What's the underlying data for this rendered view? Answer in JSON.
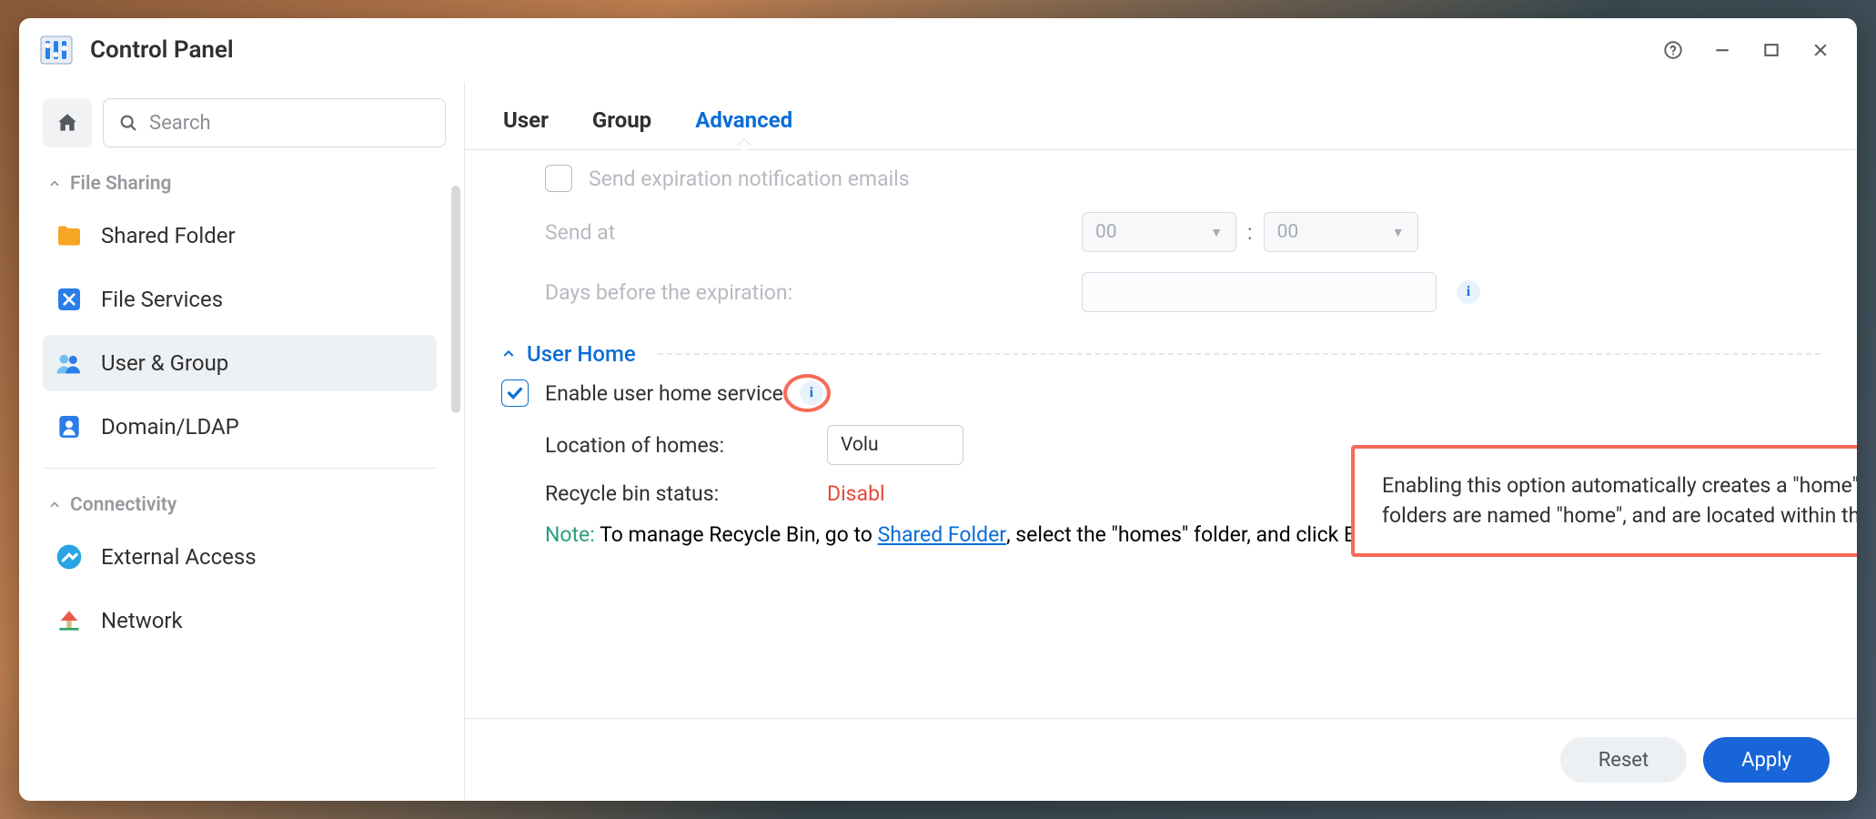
{
  "window": {
    "title": "Control Panel"
  },
  "sidebar": {
    "search_placeholder": "Search",
    "sections": [
      {
        "title": "File Sharing"
      },
      {
        "title": "Connectivity"
      }
    ],
    "items": {
      "shared_folder": "Shared Folder",
      "file_services": "File Services",
      "user_group": "User & Group",
      "domain_ldap": "Domain/LDAP",
      "external_access": "External Access",
      "network": "Network"
    }
  },
  "tabs": {
    "user": "User",
    "group": "Group",
    "advanced": "Advanced"
  },
  "settings": {
    "send_expiration_label": "Send expiration notification emails",
    "send_at_label": "Send at",
    "send_at_hour": "00",
    "send_at_min": "00",
    "days_before_label": "Days before the expiration:",
    "section_user_home": "User Home",
    "enable_home_label": "Enable user home service",
    "location_label": "Location of homes:",
    "location_value": "Volu",
    "recycle_label": "Recycle bin status:",
    "recycle_value": "Disabl",
    "note_label": "Note:",
    "note_prefix": " To manage Recycle Bin, go to ",
    "note_link": "Shared Folder",
    "note_suffix": ", select the \"homes\" folder, and click Edit"
  },
  "tooltip": {
    "text": "Enabling this option automatically creates a \"home\" folder for each user. All users' personal folders are named \"home\", and are located within the \"homes\" folder."
  },
  "footer": {
    "reset": "Reset",
    "apply": "Apply"
  }
}
